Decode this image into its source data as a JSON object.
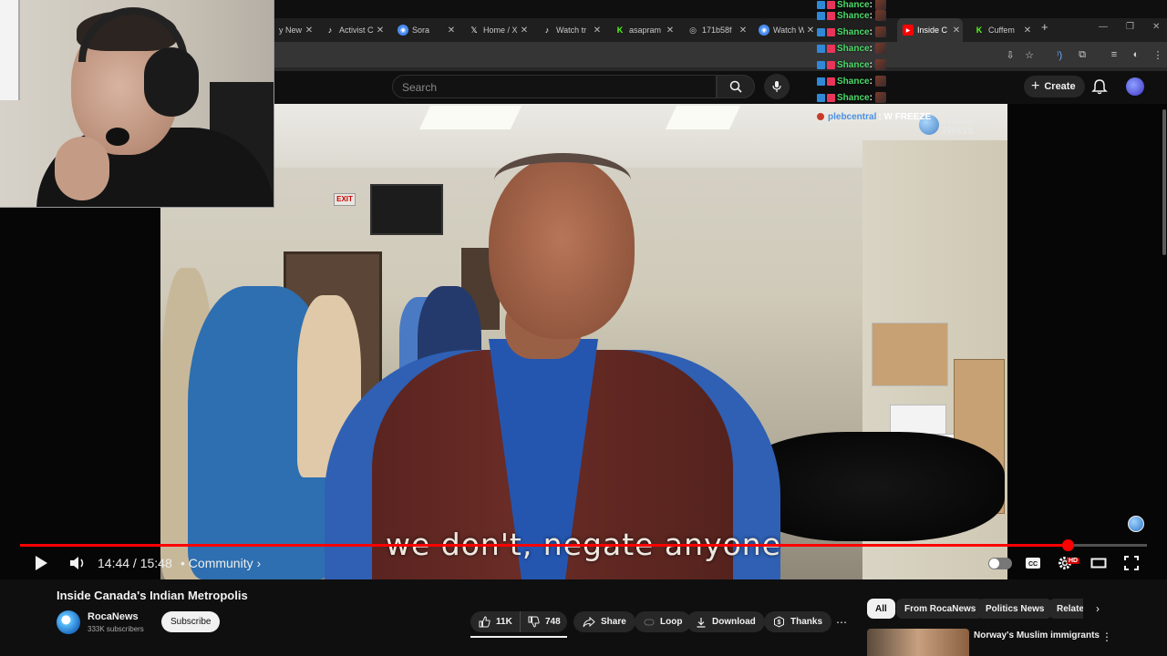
{
  "browser": {
    "tabs": [
      {
        "label": "y New",
        "favicon": "generic",
        "active": false
      },
      {
        "label": "Activist C",
        "favicon": "tiktok",
        "active": false
      },
      {
        "label": "Sora",
        "favicon": "sora",
        "active": false
      },
      {
        "label": "Home / X",
        "favicon": "x",
        "active": false
      },
      {
        "label": "Watch tr",
        "favicon": "tiktok",
        "active": false
      },
      {
        "label": "asapram",
        "favicon": "kick",
        "active": false
      },
      {
        "label": "171b58f",
        "favicon": "globe",
        "active": false
      },
      {
        "label": "Watch W",
        "favicon": "sora",
        "active": false
      },
      {
        "label": "",
        "favicon": "generic",
        "active": false
      },
      {
        "label": "Inside C",
        "favicon": "youtube",
        "active": true
      },
      {
        "label": "Cuffem",
        "favicon": "kick",
        "active": false
      }
    ],
    "new_tab_symbol": "+"
  },
  "header": {
    "search_placeholder": "Search",
    "create_label": "Create"
  },
  "chat": {
    "messages": [
      {
        "name": "Shance",
        "sep": ":"
      },
      {
        "name": "Shance",
        "sep": ":"
      },
      {
        "name": "Shance",
        "sep": ":"
      },
      {
        "name": "Shance",
        "sep": ":"
      },
      {
        "name": "Shance",
        "sep": ":"
      },
      {
        "name": "Shance",
        "sep": ":"
      },
      {
        "name": "Shance",
        "sep": ":"
      }
    ],
    "last": {
      "name": "plebcentral",
      "message": ": W FREEZE"
    }
  },
  "video": {
    "watermark": "Roca\nNews",
    "caption": "we don't, negate anyone",
    "progress": 0.93,
    "time_text": "14:44 / 15:48",
    "chapter_text": "• Community ›",
    "hd_badge": "HD",
    "colors": {
      "progress": "#ff0000"
    }
  },
  "details": {
    "title": "Inside Canada's Indian Metropolis",
    "channel": "RocaNews",
    "subscribers": "333K subscribers",
    "subscribe_label": "Subscribe",
    "likes": "11K",
    "dislikes": "748",
    "share_label": "Share",
    "loop_label": "Loop",
    "download_label": "Download",
    "thanks_label": "Thanks",
    "more_symbol": "⋯"
  },
  "chips": {
    "items": [
      "All",
      "From RocaNews",
      "Politics News",
      "Relate"
    ],
    "active_index": 0
  },
  "recommendation": {
    "title": "Norway's Muslim immigrants",
    "menu_symbol": "⋮"
  }
}
